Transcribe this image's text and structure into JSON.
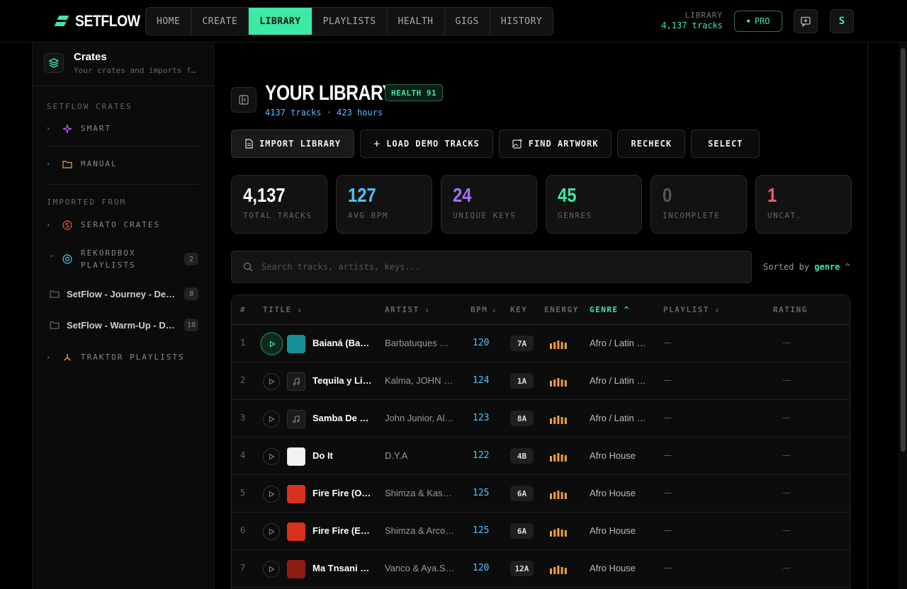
{
  "brand": {
    "name": "SETFLOW",
    "accent": "#3ee8a6"
  },
  "nav": {
    "items": [
      {
        "label": "HOME"
      },
      {
        "label": "CREATE"
      },
      {
        "label": "LIBRARY",
        "active": true
      },
      {
        "label": "PLAYLISTS"
      },
      {
        "label": "HEALTH"
      },
      {
        "label": "GIGS"
      },
      {
        "label": "HISTORY"
      }
    ]
  },
  "header": {
    "library_label": "LIBRARY",
    "library_count": "4,137 tracks",
    "pro_label": "PRO",
    "feedback_icon": "message-plus-icon",
    "avatar_initial": "S"
  },
  "sidebar": {
    "title": "Crates",
    "subtitle": "Your crates and imports f…",
    "section_setflow": "SETFLOW CRATES",
    "smart_label": "SMART",
    "manual_label": "MANUAL",
    "section_imported": "IMPORTED FROM",
    "serato_label": "SERATO CRATES",
    "rekordbox_label_1": "REKORDBOX",
    "rekordbox_label_2": "PLAYLISTS",
    "rekordbox_count": "2",
    "playlists": [
      {
        "name": "SetFlow - Journey - Deep…",
        "count": "8"
      },
      {
        "name": "SetFlow - Warm-Up - D…",
        "count": "10"
      }
    ],
    "traktor_label": "TRAKTOR PLAYLISTS"
  },
  "main": {
    "title": "YOUR LIBRARY",
    "health_badge": "HEALTH 91",
    "subtitle": "4137 tracks · 423 hours",
    "actions": {
      "import": "IMPORT LIBRARY",
      "demo": "LOAD DEMO TRACKS",
      "artwork": "FIND ARTWORK",
      "recheck": "RECHECK",
      "select": "SELECT"
    },
    "stats": [
      {
        "value": "4,137",
        "label": "TOTAL TRACKS",
        "color": "#ffffff"
      },
      {
        "value": "127",
        "label": "AVG BPM",
        "color": "#4cc4ff"
      },
      {
        "value": "24",
        "label": "UNIQUE KEYS",
        "color": "#a070ff"
      },
      {
        "value": "45",
        "label": "GENRES",
        "color": "#3ee8a6"
      },
      {
        "value": "0",
        "label": "INCOMPLETE",
        "color": "#555555"
      },
      {
        "value": "1",
        "label": "UNCAT.",
        "color": "#ff5a6e"
      }
    ],
    "search_placeholder": "Search tracks, artists, keys...",
    "sorted_prefix": "Sorted by",
    "sorted_field": "genre",
    "table": {
      "headers": {
        "num": "#",
        "title": "TITLE",
        "artist": "ARTIST",
        "bpm": "BPM",
        "key": "KEY",
        "energy": "ENERGY",
        "genre": "GENRE",
        "playlist": "PLAYLIST",
        "rating": "RATING"
      },
      "rows": [
        {
          "num": "1",
          "title": "Baianá (Bakermat Remix)",
          "artist": "Barbatuques …",
          "bpm": "120",
          "key": "7A",
          "genre": "Afro / Latin / …",
          "playlist": "—",
          "rating": "—",
          "art": "teal",
          "playing": true
        },
        {
          "num": "2",
          "title": "Tequila y Limón",
          "artist": "Kalma, JOHN …",
          "bpm": "124",
          "key": "1A",
          "genre": "Afro / Latin / …",
          "playlist": "—",
          "rating": "—",
          "art": "note"
        },
        {
          "num": "3",
          "title": "Samba De Janeiro",
          "artist": "John Junior, Al…",
          "bpm": "123",
          "key": "8A",
          "genre": "Afro / Latin / …",
          "playlist": "—",
          "rating": "—",
          "art": "note"
        },
        {
          "num": "4",
          "title": "Do It",
          "artist": "D.Y.A",
          "bpm": "122",
          "key": "4B",
          "genre": "Afro House",
          "playlist": "—",
          "rating": "—",
          "art": "white"
        },
        {
          "num": "5",
          "title": "Fire Fire (Original Mix)",
          "artist": "Shimza & Kas…",
          "bpm": "125",
          "key": "6A",
          "genre": "Afro House",
          "playlist": "—",
          "rating": "—",
          "art": "red"
        },
        {
          "num": "6",
          "title": "Fire Fire (Extended)",
          "artist": "Shimza & Arco…",
          "bpm": "125",
          "key": "6A",
          "genre": "Afro House",
          "playlist": "—",
          "rating": "—",
          "art": "red"
        },
        {
          "num": "7",
          "title": "Ma Tnsani (Original Mix)",
          "artist": "Vanco & Aya.S…",
          "bpm": "120",
          "key": "12A",
          "genre": "Afro House",
          "playlist": "—",
          "rating": "—",
          "art": "darkred"
        }
      ]
    }
  }
}
